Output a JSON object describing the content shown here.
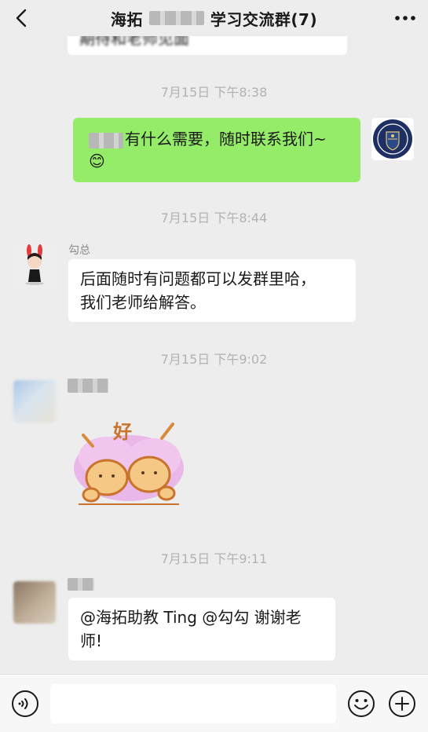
{
  "header": {
    "title_prefix": "海拓",
    "title_suffix": "学习交流群(7)"
  },
  "messages": {
    "partial_top_text": "期待和老师见面",
    "ts1": "7月15日 下午8:38",
    "m1_text": "有什么需要，随时联系我们~",
    "m1_emoji": "😊",
    "ts2": "7月15日 下午8:44",
    "m2_sender": "勾总",
    "m2_line1": "后面随时有问题都可以发群里哈，",
    "m2_line2": "我们老师给解答。",
    "ts3": "7月15日 下午9:02",
    "sticker_text": "好",
    "ts4": "7月15日 下午9:11",
    "m4_line1": "@海拓助教 Ting @勾勾 谢谢老",
    "m4_line2": "师!"
  },
  "colors": {
    "background": "#ededed",
    "self_bubble": "#95ec69",
    "other_bubble": "#ffffff",
    "timestamp": "#b2b2b2"
  },
  "icons": {
    "back": "chevron-left-icon",
    "more": "more-dots-icon",
    "voice": "voice-icon",
    "emoji": "emoji-icon",
    "plus": "plus-icon"
  }
}
